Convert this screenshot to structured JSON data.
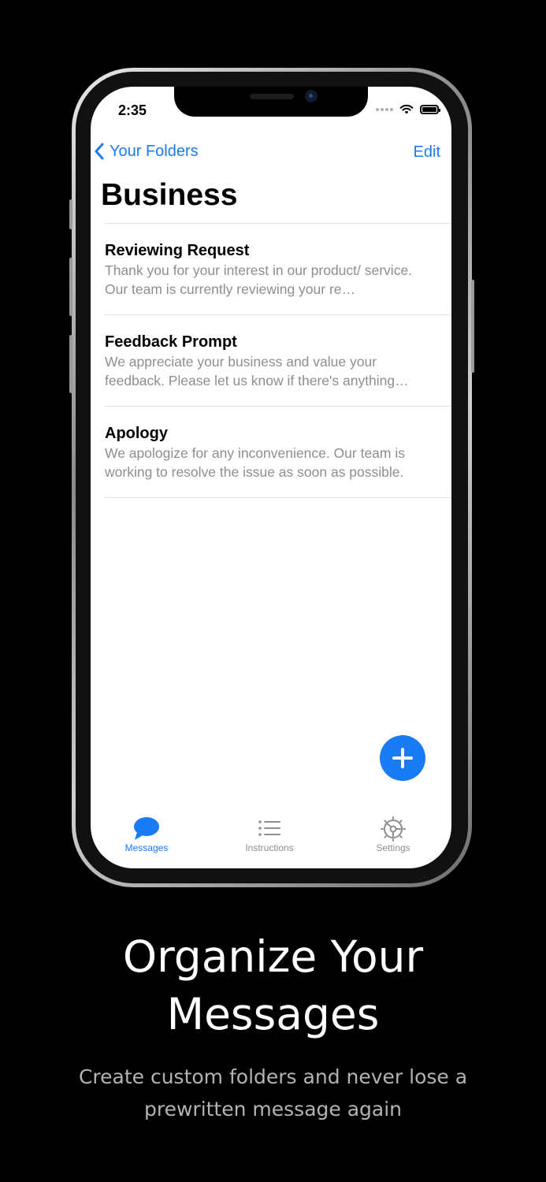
{
  "status_bar": {
    "time": "2:35"
  },
  "nav": {
    "back_label": "Your Folders",
    "edit_label": "Edit"
  },
  "page": {
    "title": "Business"
  },
  "messages": [
    {
      "title": "Reviewing Request",
      "preview": "Thank you for your interest in our product/ service. Our team is currently reviewing your re…"
    },
    {
      "title": "Feedback Prompt",
      "preview": "We appreciate your business and value your feedback. Please let us know if there's anything…"
    },
    {
      "title": "Apology",
      "preview": "We apologize for any inconvenience. Our team is working to resolve the issue as soon as possible."
    }
  ],
  "tabs": [
    {
      "label": "Messages",
      "icon": "speech-bubble-icon",
      "active": true
    },
    {
      "label": "Instructions",
      "icon": "list-icon",
      "active": false
    },
    {
      "label": "Settings",
      "icon": "gear-icon",
      "active": false
    }
  ],
  "fab": {
    "icon": "plus-icon"
  },
  "marketing": {
    "headline_line1": "Organize Your",
    "headline_line2": "Messages",
    "subline_line1": "Create custom folders and never lose a",
    "subline_line2": "prewritten message again"
  },
  "colors": {
    "accent": "#1a7cf5",
    "inactive_tab": "#8e8e8e",
    "background": "#000000"
  }
}
